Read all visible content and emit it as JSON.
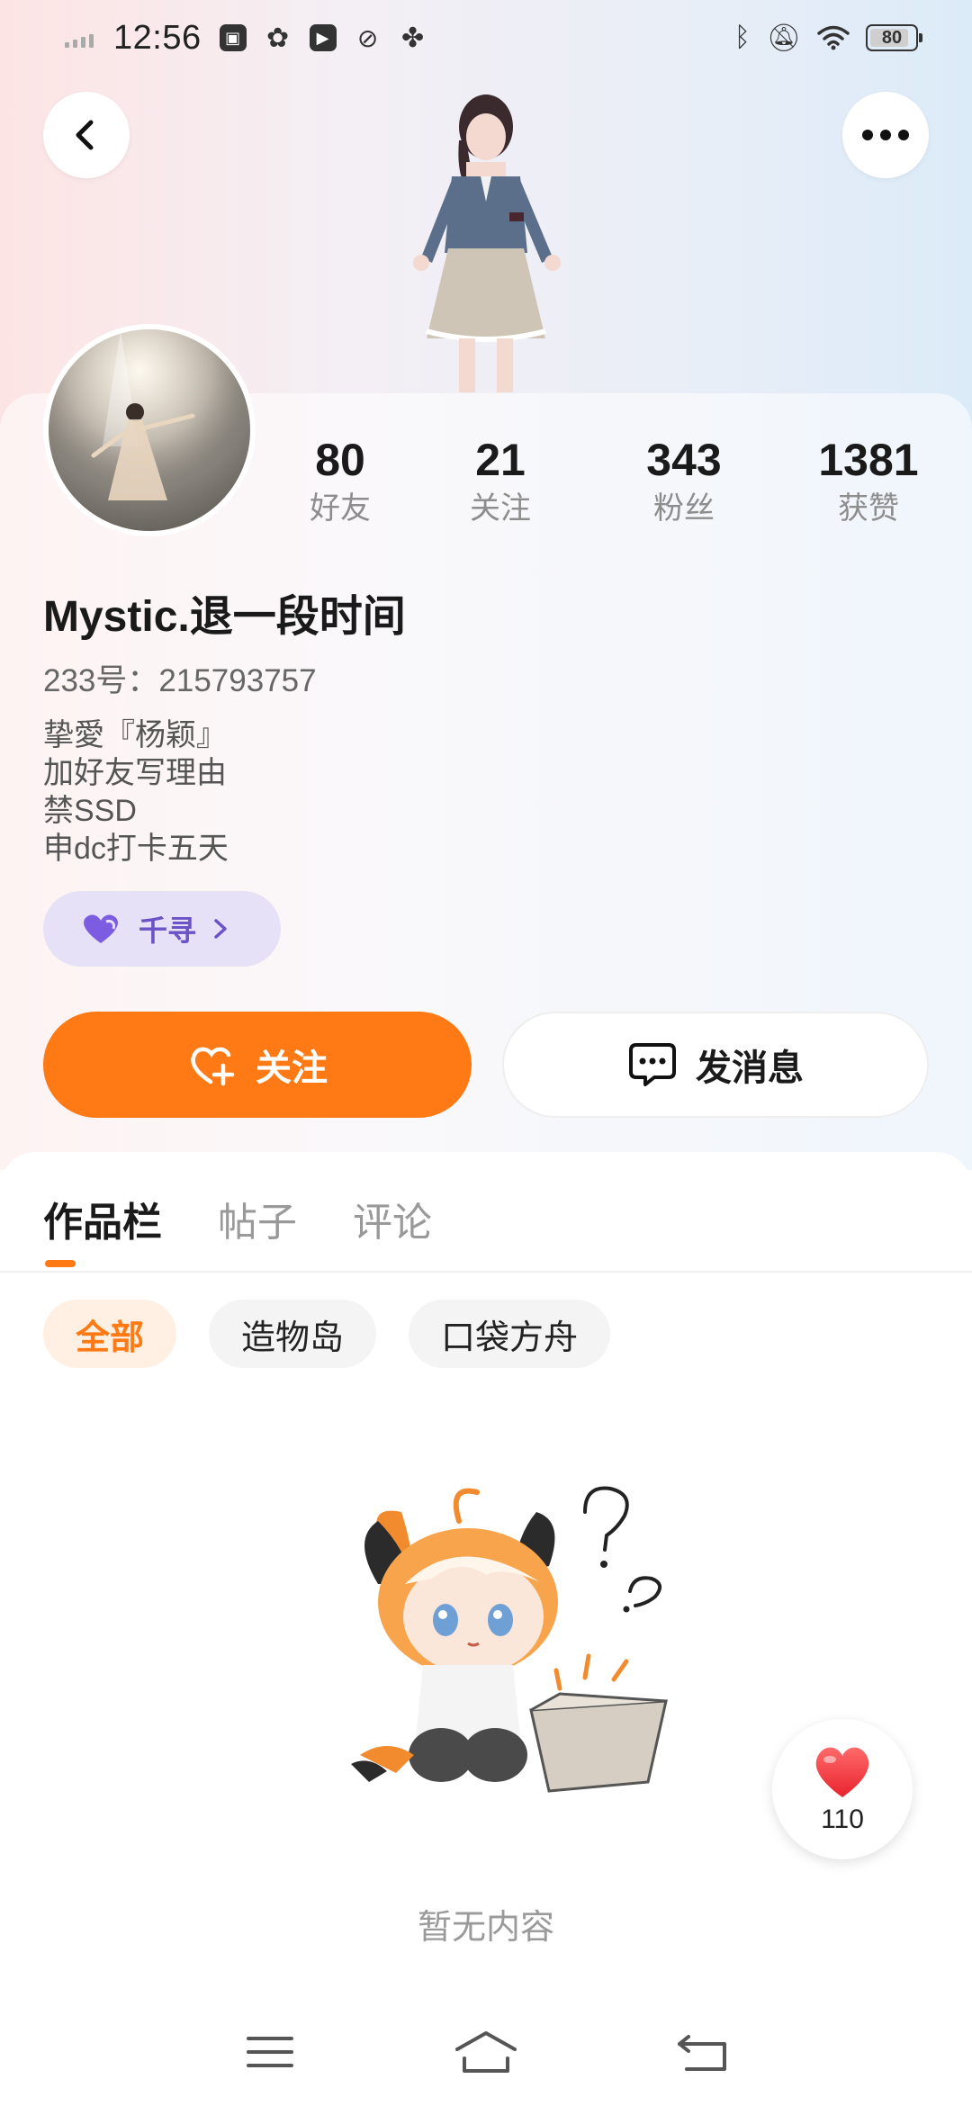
{
  "status_bar": {
    "time": "12:56",
    "battery": "80",
    "icons": [
      "signal-icon",
      "app-icon",
      "wechat-icon",
      "video-icon",
      "app-icon",
      "pinwheel-icon",
      "bluetooth-icon",
      "mute-icon",
      "wifi-icon"
    ]
  },
  "header": {
    "back_icon": "chevron-left-icon",
    "more_icon": "more-horizontal-icon"
  },
  "profile": {
    "stats": [
      {
        "value": "80",
        "label": "好友"
      },
      {
        "value": "21",
        "label": "关注"
      },
      {
        "value": "343",
        "label": "粉丝"
      },
      {
        "value": "1381",
        "label": "获赞"
      }
    ],
    "username": "Mystic.退一段时间",
    "uid": "233号：215793757",
    "bio": [
      "挚愛『杨颖』",
      "加好友写理由",
      "禁SSD",
      "申dc打卡五天"
    ],
    "tag": {
      "icon": "heart-icon",
      "label": "千寻"
    }
  },
  "actions": {
    "follow_label": "关注",
    "message_label": "发消息"
  },
  "tabs": [
    {
      "label": "作品栏",
      "active": true
    },
    {
      "label": "帖子",
      "active": false
    },
    {
      "label": "评论",
      "active": false
    }
  ],
  "filters": [
    {
      "label": "全部",
      "active": true
    },
    {
      "label": "造物岛",
      "active": false
    },
    {
      "label": "口袋方舟",
      "active": false
    }
  ],
  "empty_state": {
    "text": "暂无内容"
  },
  "like_fab": {
    "count": "110"
  },
  "colors": {
    "accent": "#ff7a14",
    "tag_bg": "#e7e1f7",
    "tag_text": "#6a52c7"
  }
}
